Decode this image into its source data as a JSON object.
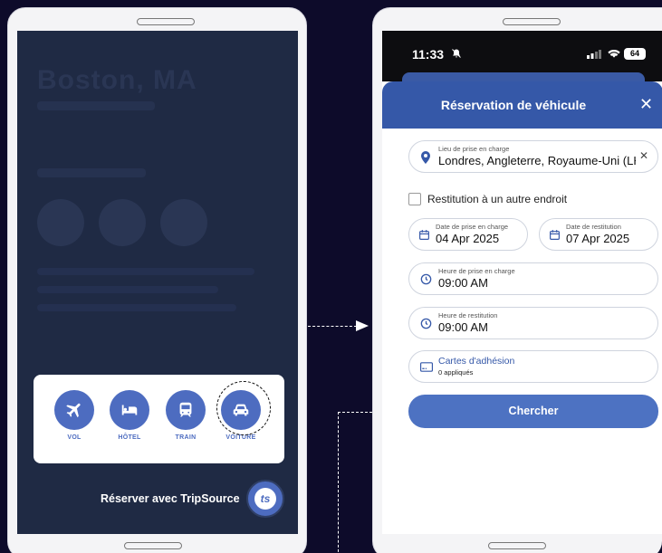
{
  "left_phone": {
    "background_city": "Boston, MA",
    "menu": {
      "items": [
        {
          "label": "VOL",
          "icon": "plane-icon"
        },
        {
          "label": "HÔTEL",
          "icon": "bed-icon"
        },
        {
          "label": "TRAIN",
          "icon": "train-icon"
        },
        {
          "label": "VOITURE",
          "icon": "car-icon"
        }
      ]
    },
    "reserve_label": "Réserver avec TripSource",
    "ts_logo_text": "ts"
  },
  "right_phone": {
    "status": {
      "time": "11:33",
      "battery": "64"
    },
    "modal_title": "Réservation de véhicule",
    "pickup_location": {
      "label": "Lieu de prise en charge",
      "value": "Londres, Angleterre, Royaume-Uni (LH"
    },
    "return_elsewhere_label": "Restitution à un autre endroit",
    "pickup_date": {
      "label": "Date de prise en charge",
      "value": "04 Apr 2025"
    },
    "return_date": {
      "label": "Date de restitution",
      "value": "07 Apr 2025"
    },
    "pickup_time": {
      "label": "Heure de prise en charge",
      "value": "09:00 AM"
    },
    "return_time": {
      "label": "Heure de restitution",
      "value": "09:00 AM"
    },
    "membership": {
      "label": "Cartes d'adhésion",
      "count": "0 appliqués"
    },
    "search_label": "Chercher"
  },
  "colors": {
    "page_bg": "#0d0b2a",
    "accent": "#4d6cc0",
    "header_blue": "#3558a8"
  }
}
